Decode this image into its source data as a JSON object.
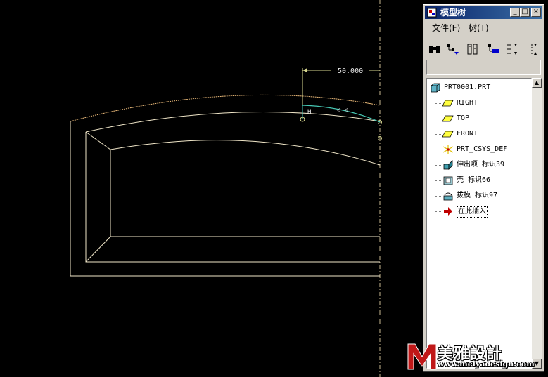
{
  "window": {
    "title": "模型树",
    "minimize_glyph": "_",
    "maximize_glyph": "□",
    "close_glyph": "×"
  },
  "menu": {
    "file": "文件(F)",
    "tree": "树(T)"
  },
  "dimension": {
    "value": "50.000",
    "h_label": "H"
  },
  "tree": {
    "root": "PRT0001.PRT",
    "items": [
      {
        "label": "RIGHT",
        "icon": "datum-plane-icon"
      },
      {
        "label": "TOP",
        "icon": "datum-plane-icon"
      },
      {
        "label": "FRONT",
        "icon": "datum-plane-icon"
      },
      {
        "label": "PRT_CSYS_DEF",
        "icon": "coordinate-system-icon"
      },
      {
        "label": "伸出项 标识39",
        "icon": "protrusion-icon"
      },
      {
        "label": "壳 标识66",
        "icon": "shell-icon"
      },
      {
        "label": "拔模 标识97",
        "icon": "draft-icon"
      },
      {
        "label": "在此插入",
        "icon": "insert-here-arrow-icon"
      }
    ]
  },
  "watermark": {
    "title": "美雅設計",
    "url": "www.meiyadesign.com"
  },
  "colors": {
    "background": "#000000",
    "geometry_lines": "#f0e6c8",
    "highlighted_sketch": "#46c8b4",
    "dimension_lines": "#d8d890",
    "window_face": "#d4d0c8",
    "titlebar": "#0a246a"
  }
}
